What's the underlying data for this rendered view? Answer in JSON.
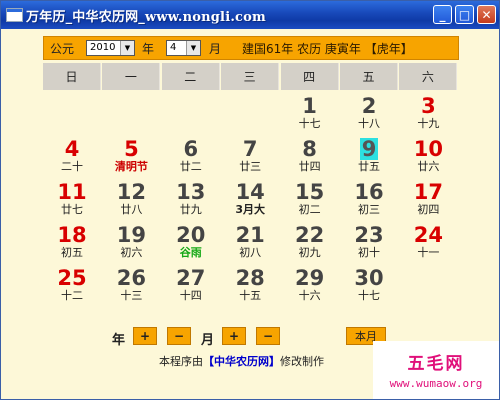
{
  "window": {
    "title": "万年历_中华农历网_www.nongli.com",
    "controls": {
      "minimize": "_",
      "maximize": "□",
      "close": "✕"
    }
  },
  "selector": {
    "era_label": "公元",
    "year_value": "2010",
    "year_label": "年",
    "month_value": "4",
    "month_label": "月",
    "lunar_info": "建国61年 农历 庚寅年 【虎年】"
  },
  "weekdays": [
    "日",
    "一",
    "二",
    "三",
    "四",
    "五",
    "六"
  ],
  "days": [
    {
      "n": "1",
      "l": "十七"
    },
    {
      "n": "2",
      "l": "十八"
    },
    {
      "n": "3",
      "l": "十九"
    },
    {
      "n": "4",
      "l": "二十"
    },
    {
      "n": "5",
      "l": "清明节"
    },
    {
      "n": "6",
      "l": "廿二"
    },
    {
      "n": "7",
      "l": "廿三"
    },
    {
      "n": "8",
      "l": "廿四"
    },
    {
      "n": "9",
      "l": "廿五"
    },
    {
      "n": "10",
      "l": "廿六"
    },
    {
      "n": "11",
      "l": "廿七"
    },
    {
      "n": "12",
      "l": "廿八"
    },
    {
      "n": "13",
      "l": "廿九"
    },
    {
      "n": "14",
      "l": "3月大"
    },
    {
      "n": "15",
      "l": "初二"
    },
    {
      "n": "16",
      "l": "初三"
    },
    {
      "n": "17",
      "l": "初四"
    },
    {
      "n": "18",
      "l": "初五"
    },
    {
      "n": "19",
      "l": "初六"
    },
    {
      "n": "20",
      "l": "谷雨"
    },
    {
      "n": "21",
      "l": "初八"
    },
    {
      "n": "22",
      "l": "初九"
    },
    {
      "n": "23",
      "l": "初十"
    },
    {
      "n": "24",
      "l": "十一"
    },
    {
      "n": "25",
      "l": "十二"
    },
    {
      "n": "26",
      "l": "十三"
    },
    {
      "n": "27",
      "l": "十四"
    },
    {
      "n": "28",
      "l": "十五"
    },
    {
      "n": "29",
      "l": "十六"
    },
    {
      "n": "30",
      "l": "十七"
    }
  ],
  "navigation": {
    "year_label": "年",
    "month_label": "月",
    "plus": "+",
    "minus": "−",
    "today_button": "本月"
  },
  "footer": {
    "prefix": "本程序由",
    "link": "【中华农历网】",
    "suffix": "修改制作"
  },
  "watermark": {
    "title": "五毛网",
    "url": "www.wumaow.org"
  },
  "colors": {
    "accent_orange": "#f7a400",
    "weekend_red": "#d80000",
    "today_highlight": "#2de0e0",
    "title_blue": "#1747b8"
  }
}
